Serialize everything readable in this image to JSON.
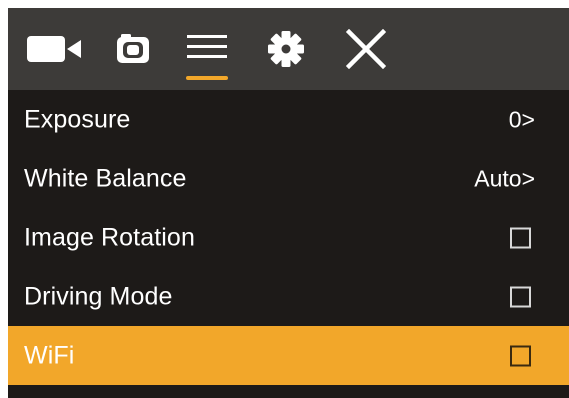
{
  "colors": {
    "top_bar_bg": "#3d3b39",
    "screen_bg": "#1d1a18",
    "accent": "#f2a72a",
    "text": "#ffffff",
    "icon": "#ffffff"
  },
  "tabs": [
    {
      "name": "tab-video",
      "icon": "video-camera-icon",
      "selected": false
    },
    {
      "name": "tab-photo",
      "icon": "photo-camera-icon",
      "selected": false
    },
    {
      "name": "tab-menu",
      "icon": "hamburger-menu-icon",
      "selected": true
    },
    {
      "name": "tab-settings",
      "icon": "gear-icon",
      "selected": false
    },
    {
      "name": "tab-close",
      "icon": "close-icon",
      "selected": false
    }
  ],
  "menu": {
    "items": [
      {
        "label": "Exposure",
        "control": "value",
        "value": "0>",
        "checked": false,
        "selected": false
      },
      {
        "label": "White Balance",
        "control": "value",
        "value": "Auto>",
        "checked": false,
        "selected": false
      },
      {
        "label": "Image Rotation",
        "control": "checkbox",
        "checked": false,
        "selected": false
      },
      {
        "label": "Driving Mode",
        "control": "checkbox",
        "checked": false,
        "selected": false
      },
      {
        "label": "WiFi",
        "control": "checkbox",
        "checked": false,
        "selected": true
      }
    ]
  }
}
